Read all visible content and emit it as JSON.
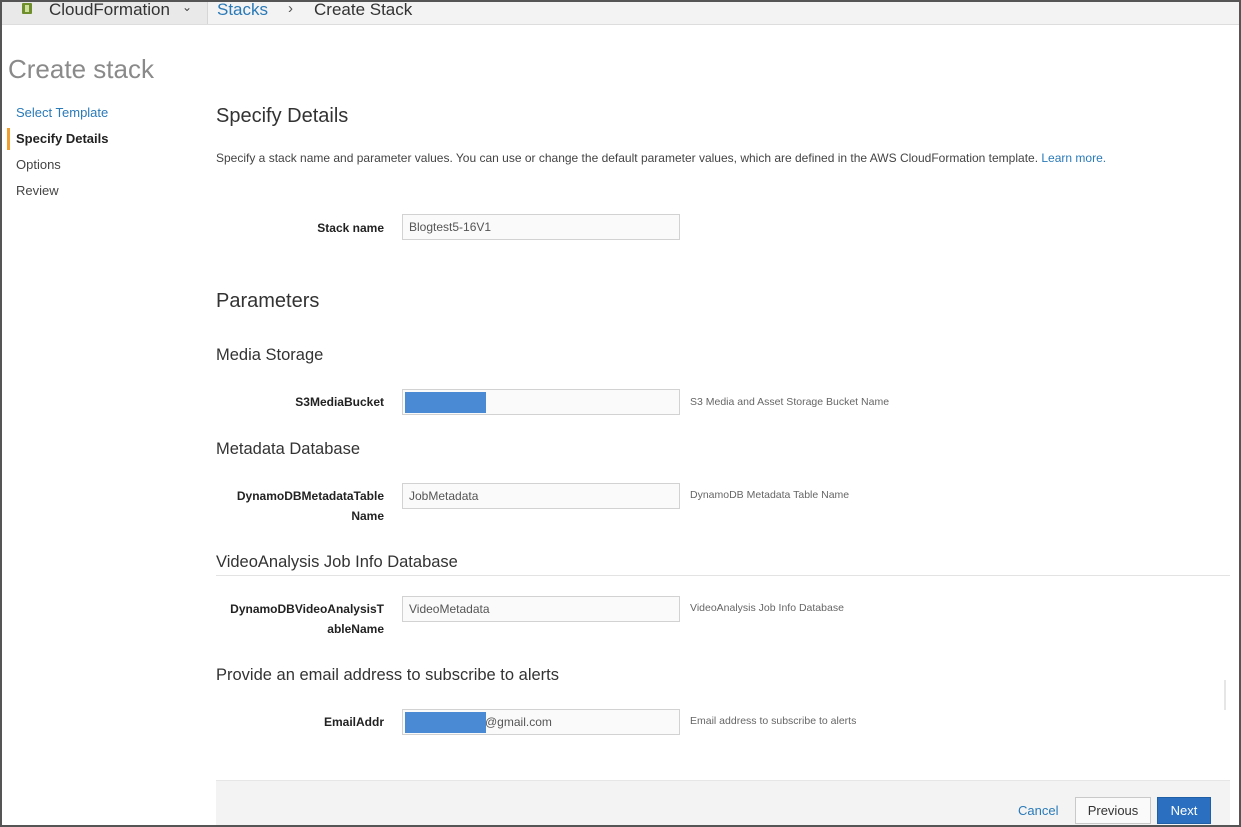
{
  "topbar": {
    "service": "CloudFormation",
    "caret": "⌄",
    "breadcrumb": {
      "stacks": "Stacks",
      "separator": "›",
      "current": "Create Stack"
    }
  },
  "page_title": "Create stack",
  "steps": [
    "Select Template",
    "Specify Details",
    "Options",
    "Review"
  ],
  "main": {
    "heading": "Specify Details",
    "description": "Specify a stack name and parameter values. You can use or change the default parameter values, which are defined in the AWS CloudFormation template.",
    "learn_more": "Learn more.",
    "stack_name": {
      "label": "Stack name",
      "value": "Blogtest5-16V1"
    },
    "parameters_heading": "Parameters",
    "groups": {
      "media": {
        "title": "Media Storage",
        "label": "S3MediaBucket",
        "value": "",
        "hint": "S3 Media and Asset Storage Bucket Name"
      },
      "metadata": {
        "title": "Metadata Database",
        "label_line1": "DynamoDBMetadataTable",
        "label_line2": "Name",
        "value": "JobMetadata",
        "hint": "DynamoDB Metadata Table Name"
      },
      "video": {
        "title": "VideoAnalysis Job Info Database",
        "label_line1": "DynamoDBVideoAnalysisT",
        "label_line2": "ableName",
        "value": "VideoMetadata",
        "hint": "VideoAnalysis Job Info Database"
      },
      "email": {
        "title": "Provide an email address to subscribe to alerts",
        "label": "EmailAddr",
        "value_suffix": "@gmail.com",
        "hint": "Email address to subscribe to alerts"
      }
    }
  },
  "footer": {
    "cancel": "Cancel",
    "previous": "Previous",
    "next": "Next"
  },
  "colors": {
    "link": "#2a7ab8",
    "primary_button": "#2b6fc0",
    "active_step_marker": "#f0a030",
    "redaction": "#4a8ad4"
  }
}
